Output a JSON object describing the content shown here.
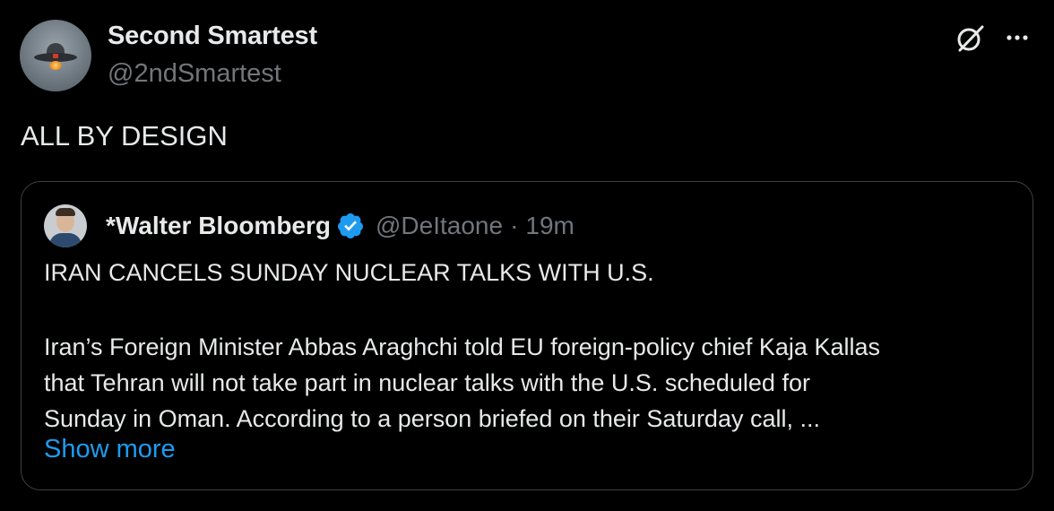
{
  "post": {
    "author_name": "Second Smartest",
    "author_handle": "@2ndSmartest",
    "text": "ALL BY DESIGN",
    "avatar_icon": "ufo-avatar",
    "actions": {
      "grok_icon": "grok-icon",
      "more_icon": "more-dots-icon"
    }
  },
  "quoted_post": {
    "author_name": "*Walter Bloomberg",
    "verified_icon": "verified-badge-icon",
    "author_handle": "@DeItaone",
    "separator": "·",
    "time": "19m",
    "headline": "IRAN CANCELS SUNDAY NUCLEAR TALKS WITH U.S.",
    "body_lines": [
      "Iran’s Foreign Minister Abbas Araghchi told EU foreign-policy chief Kaja Kallas",
      "that Tehran will not take part in nuclear talks with the U.S. scheduled for",
      "Sunday in Oman. According to a person briefed on their Saturday call, ..."
    ],
    "show_more_label": "Show more"
  },
  "colors": {
    "background": "#000000",
    "text_primary": "#e7e9ea",
    "text_secondary": "#71767b",
    "link": "#1d9bf0",
    "border": "#3e4144"
  }
}
